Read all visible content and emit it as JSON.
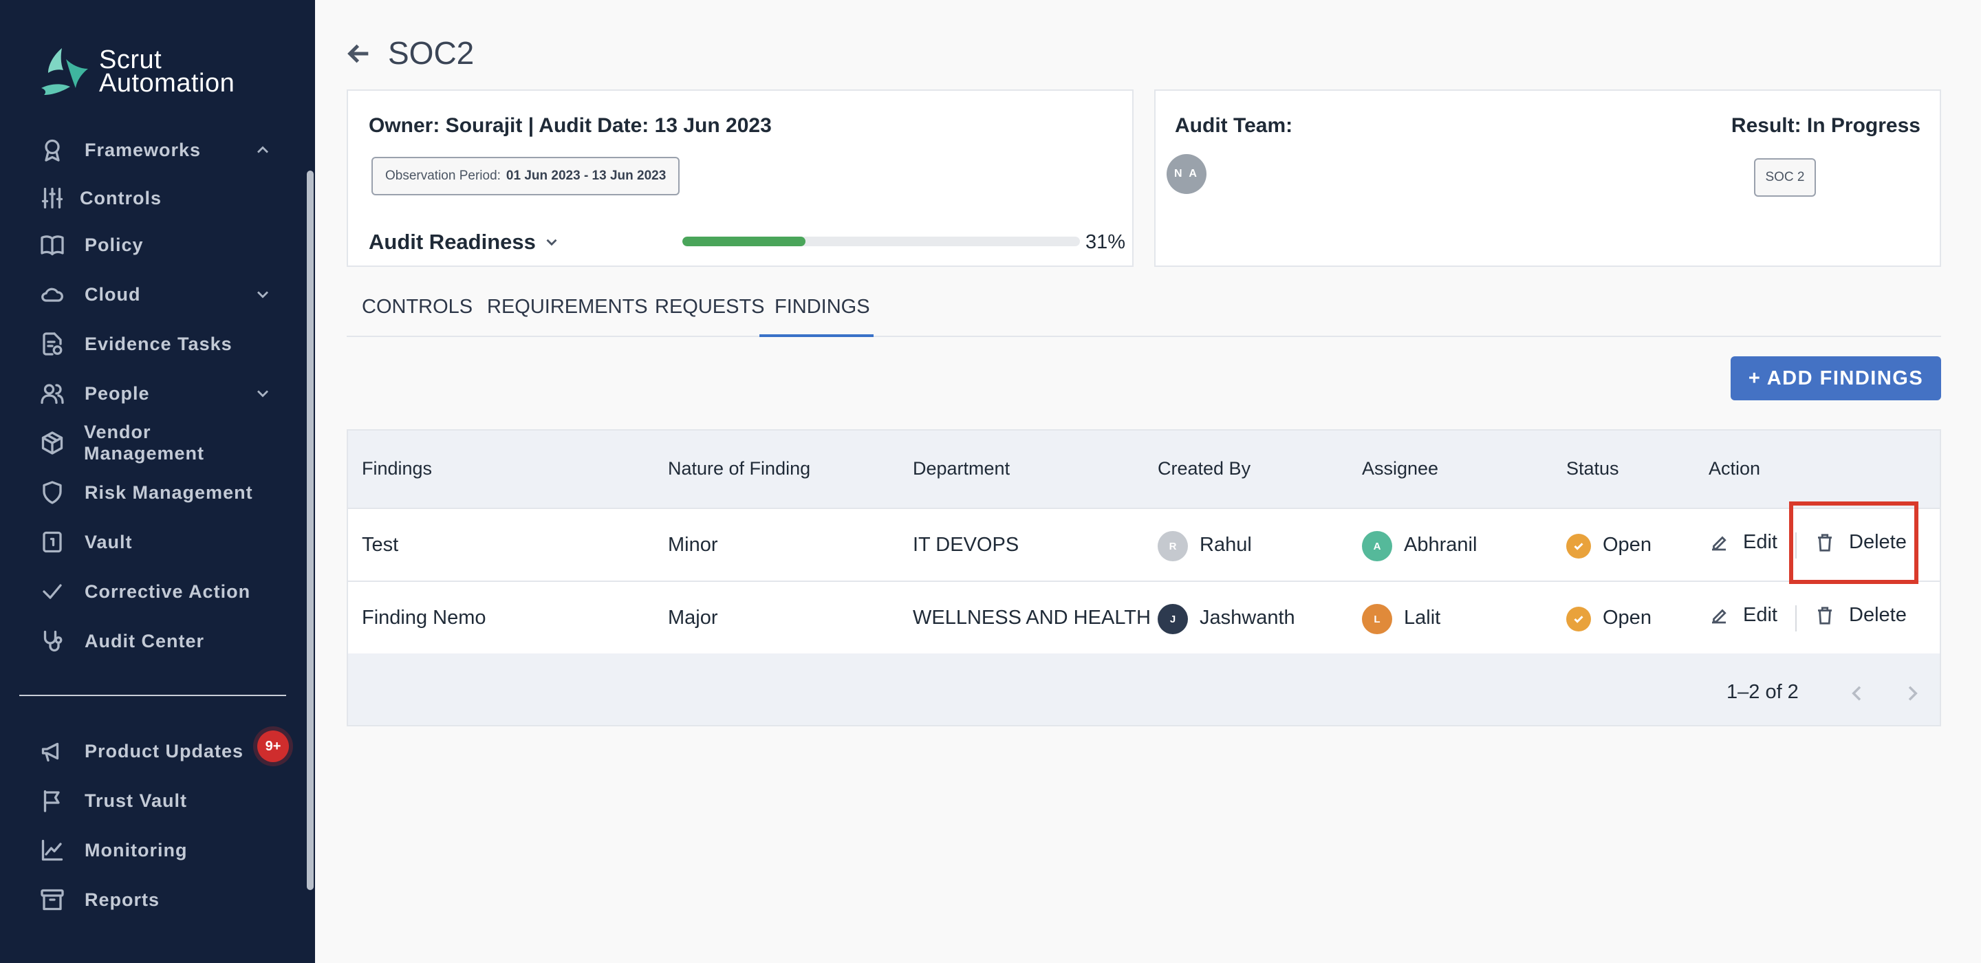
{
  "app": {
    "logo_line1": "Scrut",
    "logo_line2": "Automation"
  },
  "sidebar": {
    "items": [
      {
        "label": "Frameworks"
      },
      {
        "label": "Controls"
      },
      {
        "label": "Policy"
      },
      {
        "label": "Cloud"
      },
      {
        "label": "Evidence Tasks"
      },
      {
        "label": "People"
      },
      {
        "label": "Vendor Management"
      },
      {
        "label": "Risk Management"
      },
      {
        "label": "Vault"
      },
      {
        "label": "Corrective Action"
      },
      {
        "label": "Audit Center"
      }
    ],
    "bottom_items": [
      {
        "label": "Product Updates",
        "badge": "9+"
      },
      {
        "label": "Trust Vault"
      },
      {
        "label": "Monitoring"
      },
      {
        "label": "Reports"
      }
    ]
  },
  "page": {
    "title": "SOC2"
  },
  "summary": {
    "owner_line": "Owner: Sourajit | Audit Date: 13 Jun 2023",
    "observation_label": "Observation Period:",
    "observation_value": "01 Jun 2023 - 13 Jun 2023",
    "readiness_label": "Audit Readiness",
    "readiness_percent": 31,
    "readiness_text": "31%"
  },
  "team": {
    "title": "Audit Team:",
    "avatar_initials": "N A",
    "result": "Result: In Progress",
    "framework_tag": "SOC 2"
  },
  "tabs": [
    {
      "label": "CONTROLS"
    },
    {
      "label": "REQUIREMENTS"
    },
    {
      "label": "REQUESTS"
    },
    {
      "label": "FINDINGS",
      "active": true
    }
  ],
  "add_button": "+ ADD FINDINGS",
  "table": {
    "headers": [
      "Findings",
      "Nature of Finding",
      "Department",
      "Created By",
      "Assignee",
      "Status",
      "Action"
    ],
    "rows": [
      {
        "finding": "Test",
        "nature": "Minor",
        "department": "IT DEVOPS",
        "created_by": "Rahul",
        "created_initial": "R",
        "assignee": "Abhranil",
        "assignee_initial": "A",
        "status": "Open",
        "edit": "Edit",
        "delete": "Delete"
      },
      {
        "finding": "Finding Nemo",
        "nature": "Major",
        "department": "WELLNESS AND HEALTH",
        "created_by": "Jashwanth",
        "created_initial": "J",
        "assignee": "Lalit",
        "assignee_initial": "L",
        "status": "Open",
        "edit": "Edit",
        "delete": "Delete"
      }
    ],
    "pagination": "1–2 of 2"
  },
  "colors": {
    "sidebar_bg": "#13203a",
    "accent": "#4472c4",
    "progress": "#4aa55a",
    "status_open": "#e9a23b",
    "highlight": "#d93a2b"
  }
}
